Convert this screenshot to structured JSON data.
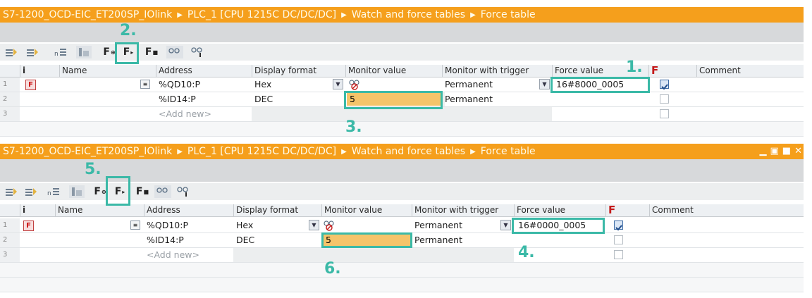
{
  "panels": [
    {
      "title": {
        "project": "S7-1200_OCD-EIC_ET200SP_IOlink",
        "plc": "PLC_1 [CPU 1215C DC/DC/DC]",
        "folder": "Watch and force tables",
        "table": "Force table"
      },
      "columns": [
        "i",
        "Name",
        "Address",
        "Display format",
        "Monitor value",
        "Monitor with trigger",
        "Force value",
        "F",
        "Comment"
      ],
      "rows": [
        {
          "num": "1",
          "f": "F",
          "address": "%QD10:P",
          "format": "Hex",
          "monitor": "",
          "trigger": "Permanent",
          "force": "16#8000_0005",
          "checked": true
        },
        {
          "num": "2",
          "f": "",
          "address": "%ID14:P",
          "format": "DEC",
          "monitor": "5",
          "trigger": "Permanent",
          "force": "",
          "checked": false
        },
        {
          "num": "3",
          "f": "",
          "address": "<Add new>",
          "format": "",
          "monitor": "",
          "trigger": "",
          "force": "",
          "checked": false
        }
      ],
      "callouts": {
        "a": "1.",
        "b": "2.",
        "c": "3."
      }
    },
    {
      "title": {
        "project": "S7-1200_OCD-EIC_ET200SP_IOlink",
        "plc": "PLC_1 [CPU 1215C DC/DC/DC]",
        "folder": "Watch and force tables",
        "table": "Force table"
      },
      "columns": [
        "i",
        "Name",
        "Address",
        "Display format",
        "Monitor value",
        "Monitor with trigger",
        "Force value",
        "F",
        "Comment"
      ],
      "rows": [
        {
          "num": "1",
          "f": "F",
          "address": "%QD10:P",
          "format": "Hex",
          "monitor": "",
          "trigger": "Permanent",
          "force": "16#0000_0005",
          "checked": true
        },
        {
          "num": "2",
          "f": "",
          "address": "%ID14:P",
          "format": "DEC",
          "monitor": "5",
          "trigger": "Permanent",
          "force": "",
          "checked": false
        },
        {
          "num": "3",
          "f": "",
          "address": "<Add new>",
          "format": "",
          "monitor": "",
          "trigger": "",
          "force": "",
          "checked": false
        }
      ],
      "callouts": {
        "a": "4.",
        "b": "5.",
        "c": "6."
      }
    }
  ],
  "toolbar": {
    "f_all": "F",
    "f_selected": "F",
    "f_stop": "F"
  },
  "colors": {
    "titlebar": "#f59f1c",
    "callout": "#3bb9a7",
    "monitor_highlight": "#f5c46a",
    "force_f": "#c41a1a"
  }
}
